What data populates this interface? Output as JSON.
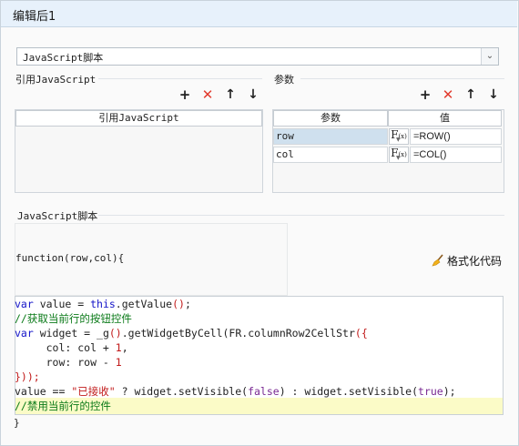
{
  "window": {
    "title": "编辑后1"
  },
  "type_select": {
    "value": "JavaScript脚本",
    "arrow": "⌄"
  },
  "ref_js": {
    "label": "引用JavaScript",
    "column_header": "引用JavaScript"
  },
  "params": {
    "label": "参数",
    "columns": [
      "参数",
      "值"
    ],
    "rows": [
      {
        "name": "row",
        "fx": "F",
        "fx_sub": "(x)",
        "value": "=ROW()"
      },
      {
        "name": "col",
        "fx": "F",
        "fx_sub": "(x)",
        "value": "=COL()"
      }
    ]
  },
  "toolbar_icons": {
    "add": "+",
    "delete": "✕",
    "up": "↑",
    "down": "↓"
  },
  "script": {
    "label": "JavaScript脚本",
    "signature": "function(row,col){",
    "format_button": "格式化代码",
    "closing": "}",
    "lines": [
      [
        {
          "t": "var",
          "c": "kw"
        },
        {
          "t": " value = "
        },
        {
          "t": "this",
          "c": "kw"
        },
        {
          "t": ".getValue"
        },
        {
          "t": "()",
          "c": "nm"
        },
        {
          "t": ";"
        }
      ],
      [
        {
          "t": "//获取当前行的按钮控件",
          "c": "cm"
        }
      ],
      [
        {
          "t": "var",
          "c": "kw"
        },
        {
          "t": " widget = _g"
        },
        {
          "t": "()",
          "c": "nm"
        },
        {
          "t": ".getWidgetByCell(FR.columnRow2CellStr"
        },
        {
          "t": "({",
          "c": "nm"
        }
      ],
      [
        {
          "t": "     col: col + "
        },
        {
          "t": "1",
          "c": "nm"
        },
        {
          "t": ","
        }
      ],
      [
        {
          "t": "     row: row - "
        },
        {
          "t": "1",
          "c": "nm"
        }
      ],
      [
        {
          "t": "}));",
          "c": "nm"
        }
      ],
      [
        {
          "t": "value == "
        },
        {
          "t": "\"已接收\"",
          "c": "st"
        },
        {
          "t": " ? widget.setVisible("
        },
        {
          "t": "false",
          "c": "fn"
        },
        {
          "t": ") : widget.setVisible("
        },
        {
          "t": "true",
          "c": "fn"
        },
        {
          "t": ");"
        }
      ],
      [
        {
          "t": "//禁用当前行的控件",
          "c": "cm"
        }
      ]
    ]
  }
}
